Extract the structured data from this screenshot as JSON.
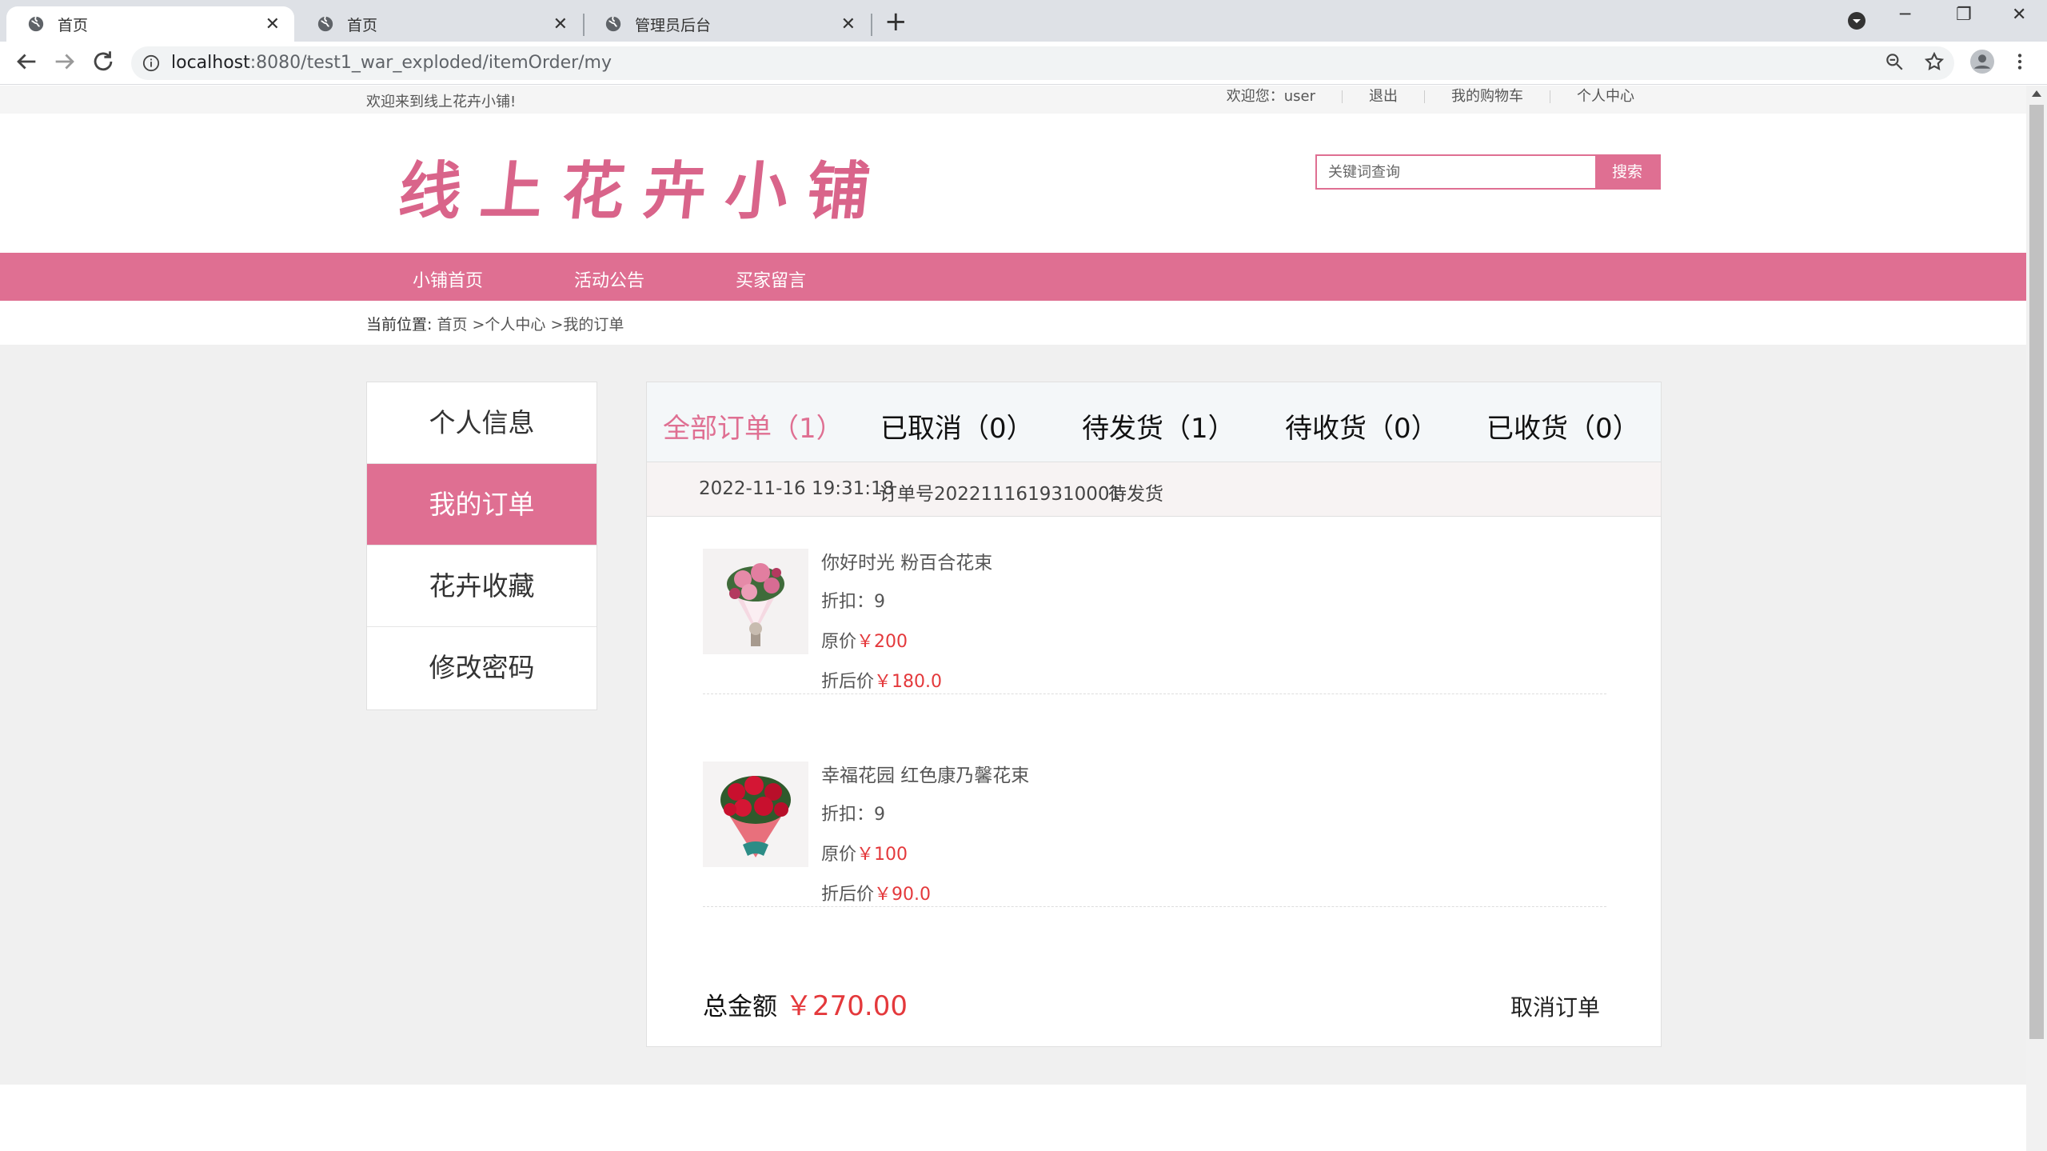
{
  "browser": {
    "tabs": [
      {
        "title": "首页",
        "active": true
      },
      {
        "title": "首页",
        "active": false
      },
      {
        "title": "管理员后台",
        "active": false
      }
    ],
    "url_host": "localhost",
    "url_path": ":8080/test1_war_exploded/itemOrder/my"
  },
  "topbar": {
    "welcome": "欢迎来到线上花卉小铺!",
    "user_greeting": "欢迎您：user",
    "logout": "退出",
    "cart": "我的购物车",
    "profile": "个人中心"
  },
  "logo": {
    "text": "线上花卉小铺"
  },
  "search": {
    "placeholder": "关键词查询",
    "button": "搜索"
  },
  "nav": [
    "小铺首页",
    "活动公告",
    "买家留言"
  ],
  "breadcrumb": {
    "label": "当前位置:",
    "trail": "首页 >个人中心 >我的订单"
  },
  "sidebar": [
    "个人信息",
    "我的订单",
    "花卉收藏",
    "修改密码"
  ],
  "order_tabs": [
    "全部订单（1）",
    "已取消（0）",
    "待发货（1）",
    "待收货（0）",
    "已收货（0）"
  ],
  "order": {
    "time": "2022-11-16 19:31:18",
    "number": "订单号2022111619310001",
    "status": "待发货",
    "items": [
      {
        "name": "你好时光 粉百合花束",
        "discount": "折扣：9",
        "orig_label": "原价",
        "orig_price": "￥200",
        "final_label": "折后价",
        "final_price": "￥180.0"
      },
      {
        "name": "幸福花园 红色康乃馨花束",
        "discount": "折扣：9",
        "orig_label": "原价",
        "orig_price": "￥100",
        "final_label": "折后价",
        "final_price": "￥90.0"
      }
    ],
    "total_label": "总金额",
    "total_amount": "￥270.00",
    "cancel_label": "取消订单"
  },
  "colors": {
    "brand_pink": "#df6f92",
    "price_red": "#e4393c"
  }
}
